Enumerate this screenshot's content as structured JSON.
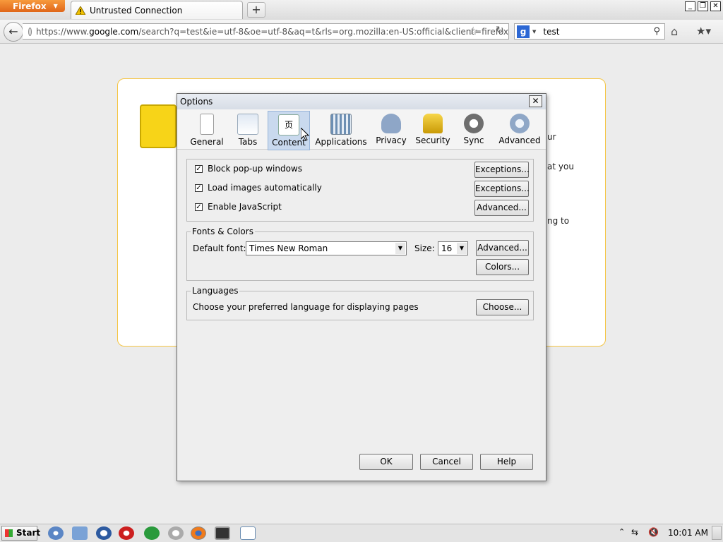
{
  "browser": {
    "app_menu_label": "Firefox",
    "tab_title": "Untrusted Connection",
    "new_tab_label": "+",
    "url_prefix": "https://www.",
    "url_host": "google.com",
    "url_rest": "/search?q=test&ie=utf-8&oe=utf-8&aq=t&rls=org.mozilla:en-US:official&client=firefox",
    "search_value": "test"
  },
  "page": {
    "peek_lines": [
      "ur",
      "at you",
      "ng to"
    ]
  },
  "dialog": {
    "title": "Options",
    "close_label": "✕",
    "panes": [
      {
        "id": "general",
        "label": "General",
        "icon": "general-switch-icon"
      },
      {
        "id": "tabs",
        "label": "Tabs",
        "icon": "tabs-icon"
      },
      {
        "id": "content",
        "label": "Content",
        "icon": "content-icon",
        "selected": true
      },
      {
        "id": "applications",
        "label": "Applications",
        "icon": "applications-icon"
      },
      {
        "id": "privacy",
        "label": "Privacy",
        "icon": "privacy-mask-icon"
      },
      {
        "id": "security",
        "label": "Security",
        "icon": "padlock-icon"
      },
      {
        "id": "sync",
        "label": "Sync",
        "icon": "sync-icon"
      },
      {
        "id": "advanced",
        "label": "Advanced",
        "icon": "gear-icon"
      }
    ],
    "content": {
      "block_popups": {
        "label": "Block pop-up windows",
        "checked": true,
        "button": "Exceptions..."
      },
      "load_images": {
        "label": "Load images automatically",
        "checked": true,
        "button": "Exceptions..."
      },
      "javascript": {
        "label": "Enable JavaScript",
        "checked": true,
        "button": "Advanced..."
      },
      "fonts": {
        "legend": "Fonts & Colors",
        "default_font_label": "Default font:",
        "default_font_value": "Times New Roman",
        "size_label": "Size:",
        "size_value": "16",
        "advanced_button": "Advanced...",
        "colors_button": "Colors..."
      },
      "languages": {
        "legend": "Languages",
        "description": "Choose your preferred language for displaying pages",
        "choose_button": "Choose..."
      }
    },
    "buttons": {
      "ok": "OK",
      "cancel": "Cancel",
      "help": "Help"
    }
  },
  "taskbar": {
    "start_label": "Start",
    "clock": "10:01 AM"
  },
  "colors": {
    "selected_pane": "#c9d9ee",
    "error_border": "#f5c542",
    "firefox_orange": "#e0661a"
  }
}
